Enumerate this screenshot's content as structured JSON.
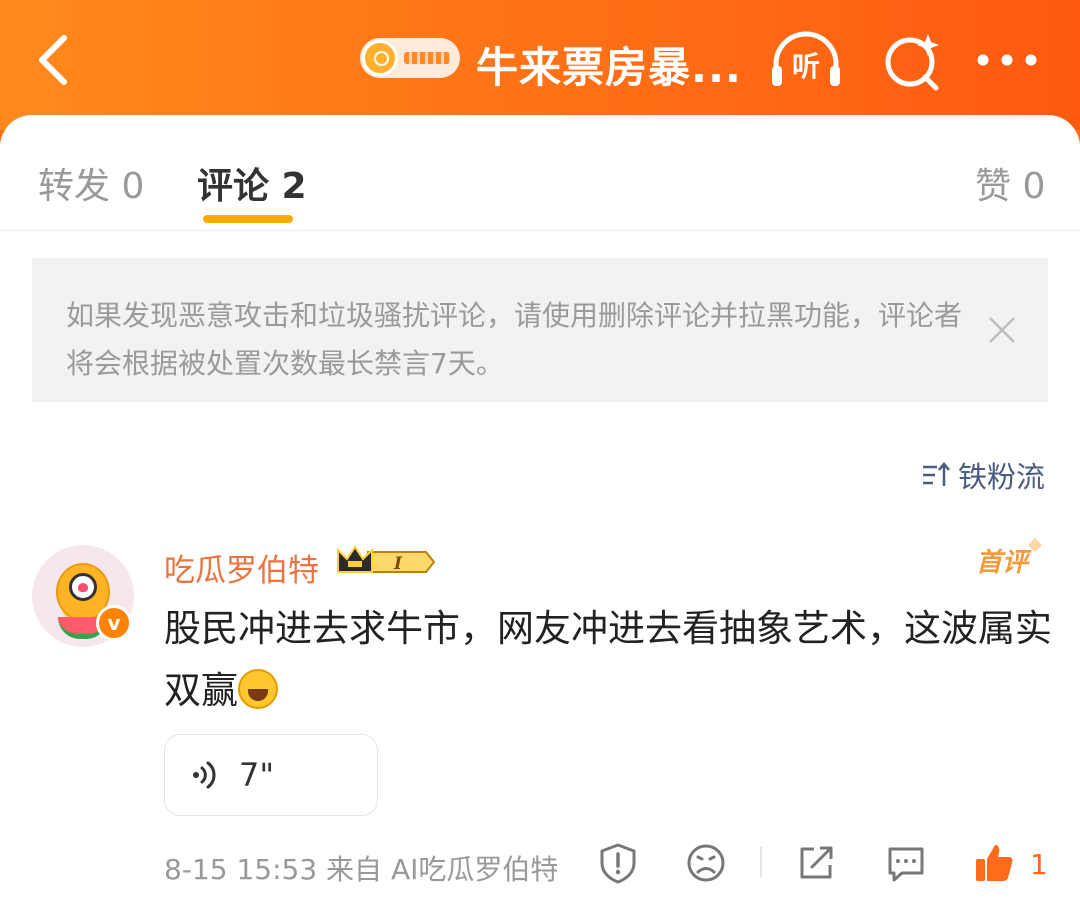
{
  "header": {
    "back_icon": "chevron-left-icon",
    "search_chip_icon": "search-icon",
    "title": "牛来票房暴...",
    "listen_label": "听",
    "colors": {
      "gradient_start": "#ff8a1c",
      "gradient_end": "#ff5a10"
    }
  },
  "tabs": [
    {
      "label": "转发 0"
    },
    {
      "label": "评论 2",
      "active": true
    },
    {
      "label": "赞 0"
    }
  ],
  "notice": {
    "text": "如果发现恶意攻击和垃圾骚扰评论，请使用删除评论并拉黑功能，评论者将会根据被处置次数最长禁言7天。",
    "close_icon": "close-icon"
  },
  "sort": {
    "label": "铁粉流",
    "icon": "sort-icon"
  },
  "comment": {
    "username": "吃瓜罗伯特",
    "level_badge": "I",
    "verified_mark": "v",
    "first_badge": "首评",
    "text": "股民冲进去求牛市，网友冲进去看抽象艺术，这波属实双赢",
    "emoji": "laughing-tears-emoji",
    "voice": {
      "duration": "7\""
    },
    "meta": "8-15 15:53  来自 AI吃瓜罗伯特",
    "likes": "1"
  },
  "colors": {
    "accent": "#ff6d12",
    "username": "#eb7340",
    "tab_underline": "#ffaa00",
    "link_blue": "#4a5d7e"
  }
}
